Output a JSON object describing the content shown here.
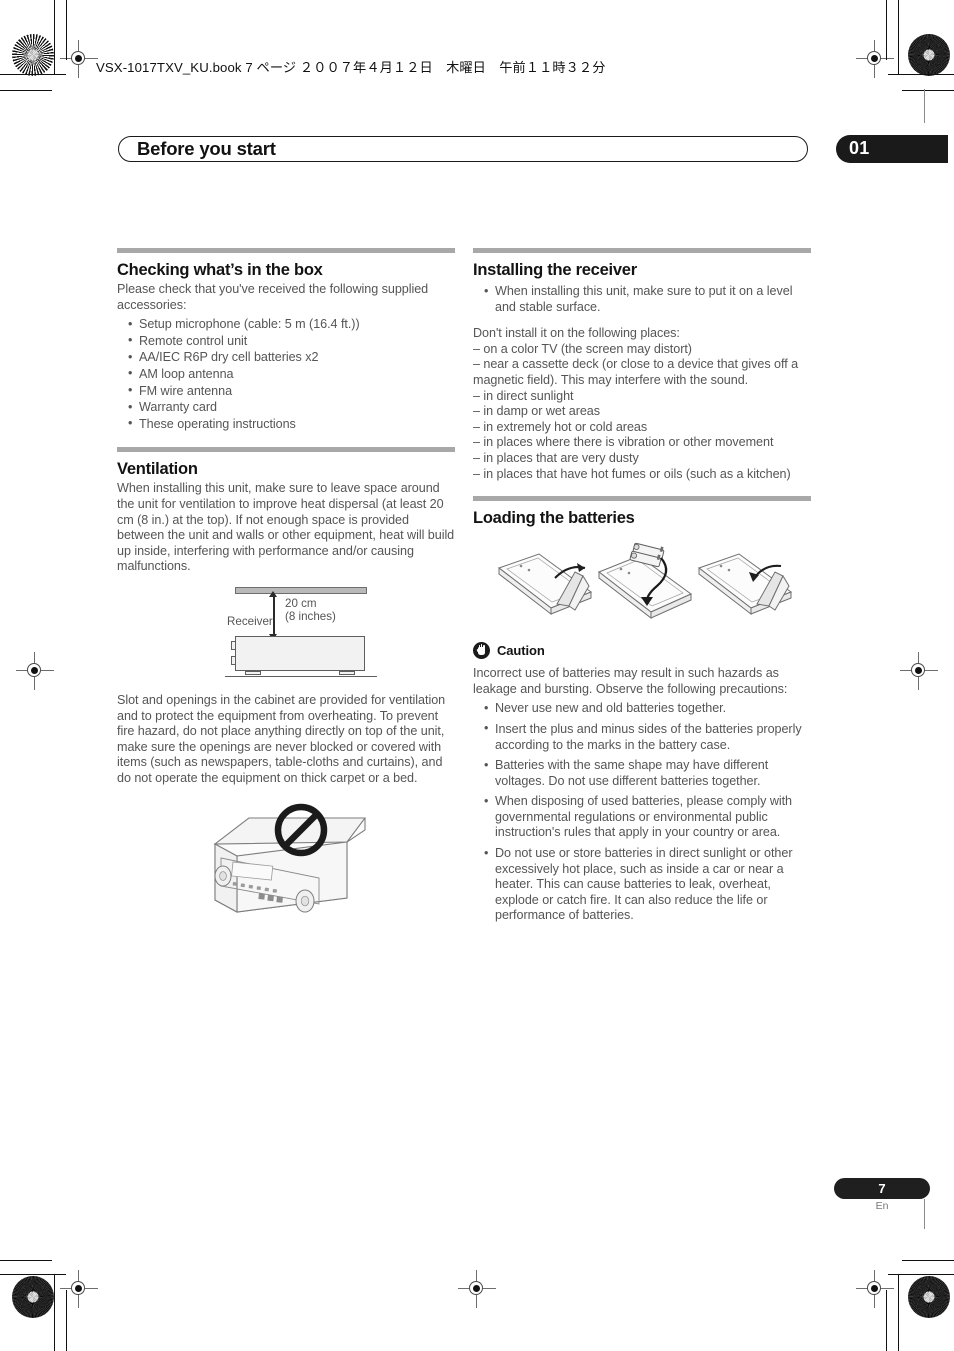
{
  "header": {
    "book_line": "VSX-1017TXV_KU.book 7 ページ ２００７年４月１２日　木曜日　午前１１時３２分",
    "chapter_title": "Before you start",
    "chapter_number": "01"
  },
  "footer": {
    "page_number": "7",
    "language": "En"
  },
  "left_column": {
    "checking": {
      "heading": "Checking what’s in the box",
      "intro": "Please check that you've received the following supplied accessories:",
      "items": [
        "Setup microphone (cable: 5 m (16.4 ft.))",
        "Remote control unit",
        "AA/IEC R6P dry cell batteries x2",
        "AM loop antenna",
        "FM wire antenna",
        "Warranty card",
        "These operating instructions"
      ]
    },
    "ventilation": {
      "heading": "Ventilation",
      "paragraph1": "When installing this unit, make sure to leave space around the unit for ventilation to improve heat dispersal (at least 20 cm (8 in.) at the top). If not enough space is provided between the unit and walls or other equipment, heat will build up inside, interfering with performance and/or causing malfunctions.",
      "diagram": {
        "receiver_label": "Receiver",
        "dimension_line1": "20 cm",
        "dimension_line2": "(8 inches)"
      },
      "paragraph2": "Slot and openings in the cabinet are provided for ventilation and to protect the equipment from overheating. To prevent fire hazard, do not place anything directly on top of the unit, make sure the openings are never blocked or covered with items (such as newspapers, table-cloths and curtains), and do not operate the equipment on thick carpet or a bed."
    }
  },
  "right_column": {
    "installing": {
      "heading": "Installing the receiver",
      "bullets": [
        "When installing this unit, make sure to put it on a level and stable surface."
      ],
      "intro": "Don't install it on the following places:",
      "dash_items": [
        "– on a color TV (the screen may distort)",
        "– near a cassette deck (or close to a device that gives off a magnetic field). This may interfere with the sound.",
        "– in direct sunlight",
        "– in damp or wet areas",
        "– in extremely hot or cold areas",
        "– in places where there is vibration or other movement",
        "– in places that are very dusty",
        "– in places that have hot fumes or oils (such as a kitchen)"
      ]
    },
    "loading": {
      "heading": "Loading the batteries",
      "caution_label": "Caution",
      "caution_intro": "Incorrect use of batteries may result in such hazards as leakage and bursting. Observe the following precautions:",
      "caution_items": [
        "Never use new and old batteries together.",
        "Insert the plus and minus sides of the batteries properly according to the marks in the battery case.",
        "Batteries with the same shape may have different voltages. Do not use different batteries together.",
        "When disposing of used batteries, please comply with governmental regulations or environmental public instruction's rules that apply in your country or area.",
        "Do not use or store batteries in direct sunlight or other excessively hot place, such as inside a car or near a heater. This can cause batteries to leak, overheat, explode or catch fire. It can also reduce the life or performance of batteries."
      ]
    }
  },
  "colors": {
    "rule": "#a8a8a8",
    "body_text": "#555555",
    "heading_text": "#131313",
    "pill": "#1a1a1a"
  }
}
